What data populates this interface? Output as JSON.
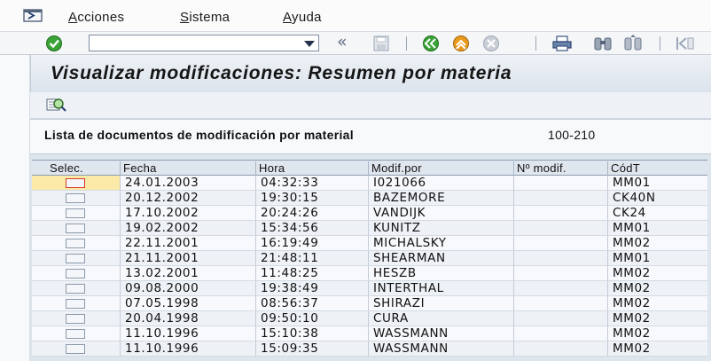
{
  "menubar": {
    "items": [
      {
        "label": "Acciones",
        "mnemonic": "A",
        "rest": "cciones"
      },
      {
        "label": "Sistema",
        "mnemonic": "S",
        "rest": "istema"
      },
      {
        "label": "Ayuda",
        "mnemonic": "A",
        "rest": "yuda"
      }
    ]
  },
  "toolbar": {
    "command_field_value": "",
    "chevron": "«",
    "icons": [
      "enter-check-icon",
      "save-icon",
      "back-icon",
      "exit-icon",
      "cancel-icon",
      "print-icon",
      "find-icon",
      "find-next-icon",
      "first-page-icon"
    ]
  },
  "title": "Visualizar modificaciones: Resumen por materia",
  "app_toolbar": {
    "icons": [
      "details-icon"
    ]
  },
  "header": {
    "label": "Lista de documentos de modificación por material",
    "material": "100-210"
  },
  "table": {
    "columns": [
      "Selec.",
      "Fecha",
      "Hora",
      "Modif.por",
      "Nº modif.",
      "CódT"
    ],
    "rows": [
      {
        "fecha": "24.01.2003",
        "hora": "04:32:33",
        "modif_por": "I021066",
        "num_modif": "",
        "codt": "MM01"
      },
      {
        "fecha": "20.12.2002",
        "hora": "19:30:15",
        "modif_por": "BAZEMORE",
        "num_modif": "",
        "codt": "CK40N"
      },
      {
        "fecha": "17.10.2002",
        "hora": "20:24:26",
        "modif_por": "VANDIJK",
        "num_modif": "",
        "codt": "CK24"
      },
      {
        "fecha": "19.02.2002",
        "hora": "15:34:56",
        "modif_por": "KUNITZ",
        "num_modif": "",
        "codt": "MM01"
      },
      {
        "fecha": "22.11.2001",
        "hora": "16:19:49",
        "modif_por": "MICHALSKY",
        "num_modif": "",
        "codt": "MM02"
      },
      {
        "fecha": "21.11.2001",
        "hora": "21:48:11",
        "modif_por": "SHEARMAN",
        "num_modif": "",
        "codt": "MM01"
      },
      {
        "fecha": "13.02.2001",
        "hora": "11:48:25",
        "modif_por": "HESZB",
        "num_modif": "",
        "codt": "MM02"
      },
      {
        "fecha": "09.08.2000",
        "hora": "19:38:49",
        "modif_por": "INTERTHAL",
        "num_modif": "",
        "codt": "MM02"
      },
      {
        "fecha": "07.05.1998",
        "hora": "08:56:37",
        "modif_por": "SHIRAZI",
        "num_modif": "",
        "codt": "MM02"
      },
      {
        "fecha": "20.04.1998",
        "hora": "09:50:10",
        "modif_por": "CURA",
        "num_modif": "",
        "codt": "MM02"
      },
      {
        "fecha": "11.10.1996",
        "hora": "15:10:38",
        "modif_por": "WASSMANN",
        "num_modif": "",
        "codt": "MM02"
      },
      {
        "fecha": "11.10.1996",
        "hora": "15:09:35",
        "modif_por": "WASSMANN",
        "num_modif": "",
        "codt": "MM02"
      }
    ]
  },
  "colors": {
    "accent_green": "#3aa336",
    "accent_orange": "#e89a1c",
    "focus_red": "#d63a2a",
    "selected_row": "#fbe9a8"
  }
}
